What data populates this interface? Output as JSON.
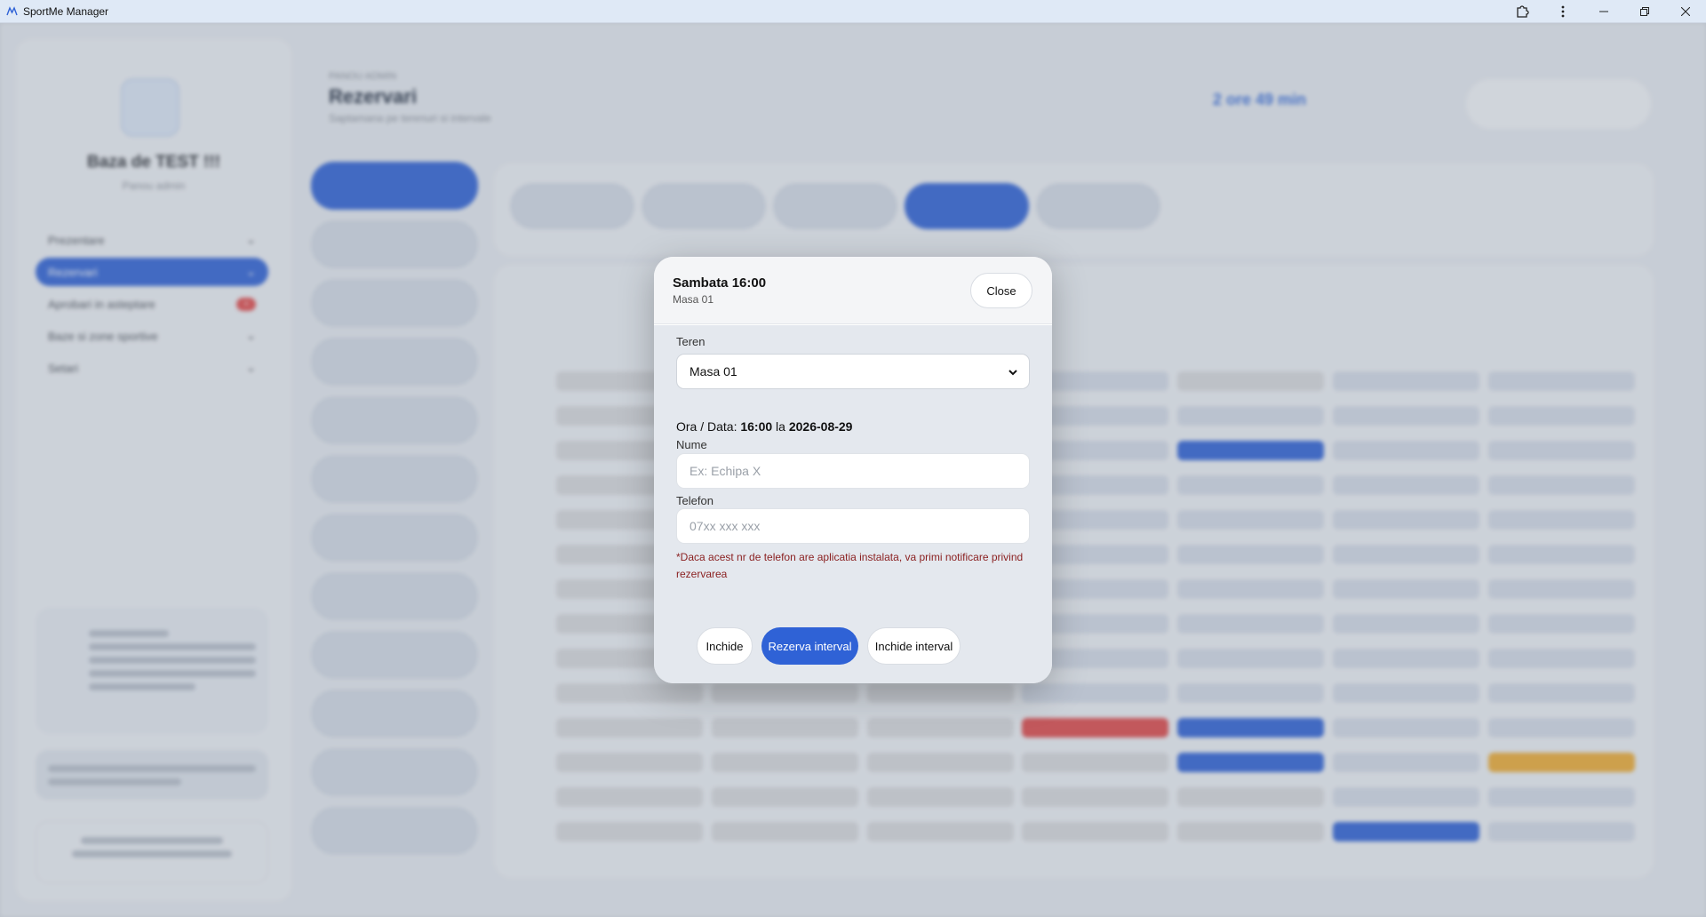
{
  "window": {
    "title": "SportMe Manager",
    "controls": [
      "extensions-icon",
      "more-icon",
      "minimize-icon",
      "restore-icon",
      "close-icon"
    ]
  },
  "background": {
    "org_name": "Baza de TEST !!!",
    "org_role": "Panou admin",
    "menu": [
      {
        "label": "Prezentare",
        "active": false
      },
      {
        "label": "Rezervari",
        "active": true
      },
      {
        "label": "Aprobari in asteptare",
        "active": false,
        "badge": "•"
      },
      {
        "label": "Baze si zone sportive",
        "active": false
      },
      {
        "label": "Setari",
        "active": false
      }
    ],
    "page_subtitle": "PANOU ADMIN",
    "page_title": "Rezervari",
    "page_desc": "Saptamana pe terenuri si intervale",
    "time_left": "2 ore 49 min",
    "colors": {
      "blue": "#2f62d6",
      "red": "#e04848",
      "orange": "#efac33",
      "free": "#d5dce8",
      "busy": "#d9dadd"
    }
  },
  "modal": {
    "title": "Sambata 16:00",
    "subtitle": "Masa 01",
    "close_label": "Close",
    "teren_label": "Teren",
    "teren_value": "Masa 01",
    "ora_prefix": "Ora / Data: ",
    "ora": "16:00",
    "ora_sep": " la ",
    "data": "2026-08-29",
    "nume_label": "Nume",
    "nume_placeholder": "Ex: Echipa X",
    "telefon_label": "Telefon",
    "telefon_placeholder": "07xx xxx xxx",
    "note": "*Daca acest nr de telefon are aplicatia instalata, va primi notificare privind rezervarea",
    "btn_inchide": "Inchide",
    "btn_rezerva": "Rezerva interval",
    "btn_inchide_interval": "Inchide interval"
  }
}
